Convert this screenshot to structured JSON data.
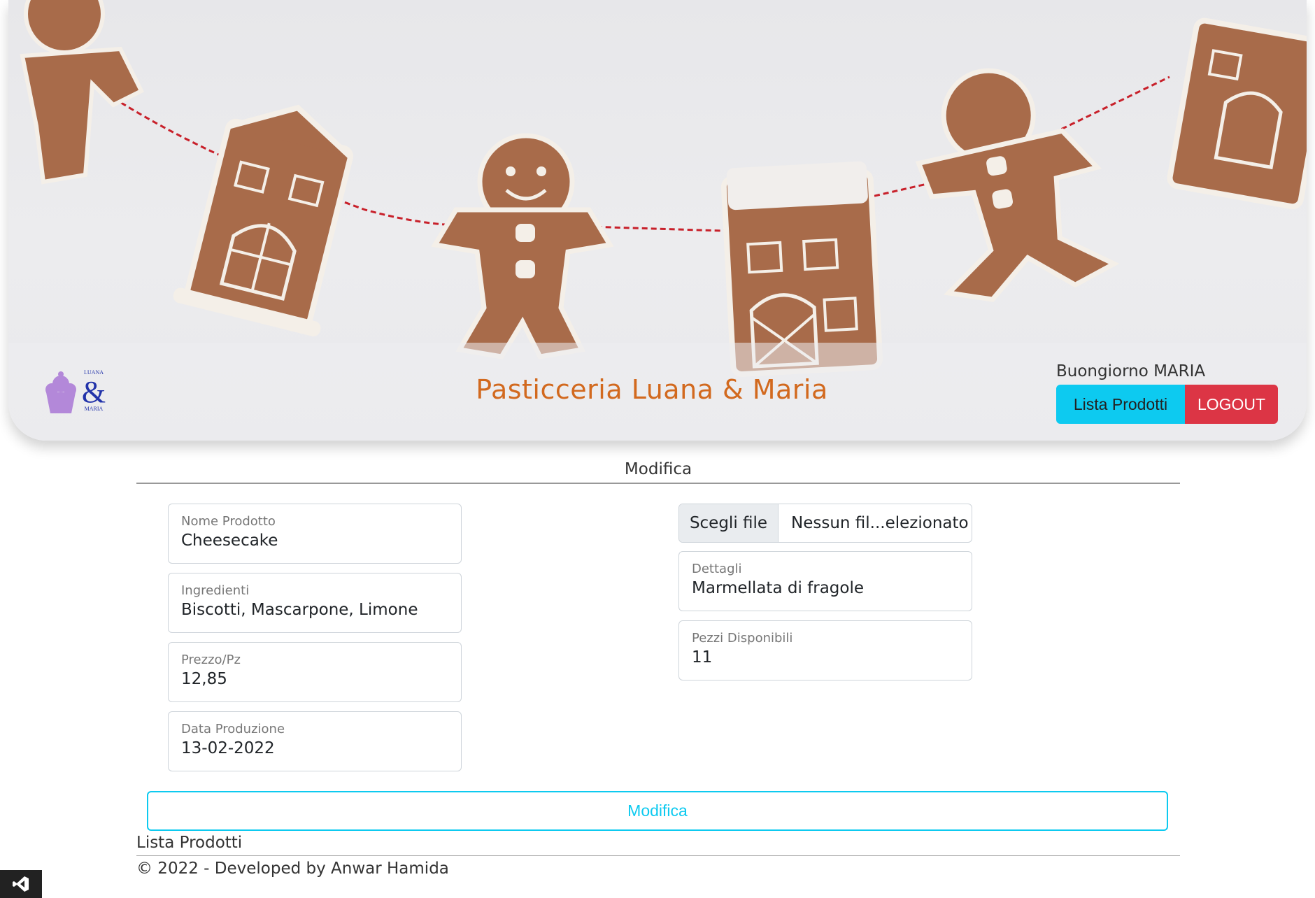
{
  "header": {
    "brand_title": "Pasticceria Luana & Maria",
    "logo_text_top": "LUANA",
    "logo_ampersand": "&",
    "logo_text_bottom": "MARIA",
    "greeting": "Buongiorno MARIA",
    "nav_lista_label": "Lista Prodotti",
    "logout_label": "LOGOUT"
  },
  "form": {
    "section_title": "Modifica",
    "left_fields": [
      {
        "label": "Nome Prodotto",
        "value": "Cheesecake"
      },
      {
        "label": "Ingredienti",
        "value": "Biscotti, Mascarpone, Limone"
      },
      {
        "label": "Prezzo/Pz",
        "value": "12,85"
      },
      {
        "label": "Data Produzione",
        "value": "13-02-2022"
      }
    ],
    "file_input": {
      "button_label": "Scegli file",
      "status": "Nessun fil...elezionato"
    },
    "right_fields": [
      {
        "label": "Dettagli",
        "value": "Marmellata di fragole"
      },
      {
        "label": "Pezzi Disponibili",
        "value": "11"
      }
    ],
    "submit_label": "Modifica"
  },
  "footer": {
    "link_label": "Lista Prodotti",
    "copyright": "© 2022 - Developed by Anwar Hamida"
  },
  "colors": {
    "accent": "#0dcaf0",
    "danger": "#dc3545",
    "brand_title": "#d2691e",
    "logo_purple": "#b388d9",
    "logo_blue": "#2233aa"
  },
  "icons": {
    "badge": "visual-studio-icon"
  }
}
